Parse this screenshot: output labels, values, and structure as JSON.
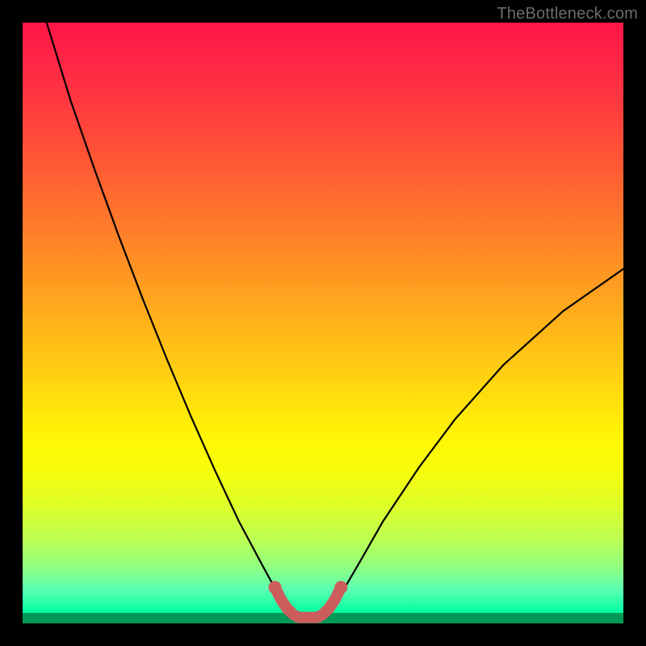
{
  "watermark": "TheBottleneck.com",
  "chart_data": {
    "type": "line",
    "title": "",
    "xlabel": "",
    "ylabel": "",
    "xlim": [
      0,
      100
    ],
    "ylim": [
      0,
      100
    ],
    "grid": false,
    "legend": false,
    "background_gradient": {
      "direction": "vertical",
      "stops": [
        {
          "pos": 0,
          "color": "#ff1647"
        },
        {
          "pos": 50,
          "color": "#ffc017"
        },
        {
          "pos": 75,
          "color": "#fff705"
        },
        {
          "pos": 100,
          "color": "#00ffa0"
        }
      ]
    },
    "series": [
      {
        "name": "bottleneck-curve",
        "stroke": "#000000",
        "x": [
          4,
          8,
          12,
          16,
          20,
          24,
          28,
          32,
          36,
          40,
          43,
          44.5,
          46,
          49.5,
          51,
          52.5,
          56,
          60,
          66,
          72,
          80,
          90,
          100
        ],
        "values": [
          100,
          87,
          75.5,
          64.5,
          54,
          44,
          34.5,
          25.5,
          17,
          9.5,
          4,
          2,
          1,
          1,
          2,
          4,
          10,
          17,
          26,
          34,
          43,
          52,
          59
        ]
      },
      {
        "name": "valley-highlight",
        "stroke": "#cd5c5c",
        "x": [
          42,
          43,
          44,
          45,
          46,
          49,
          50,
          51,
          52,
          53
        ],
        "values": [
          6,
          4,
          2.5,
          1.5,
          1,
          1,
          1.5,
          2.5,
          4,
          6
        ]
      }
    ]
  }
}
